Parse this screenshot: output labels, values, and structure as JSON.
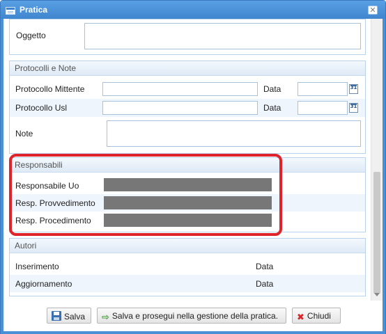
{
  "window": {
    "title": "Pratica",
    "close_glyph": "✕"
  },
  "oggetto": {
    "label": "Oggetto",
    "value": ""
  },
  "protocolli": {
    "header": "Protocolli e Note",
    "mittente_label": "Protocollo Mittente",
    "mittente_value": "",
    "usl_label": "Protocollo Usl",
    "usl_value": "",
    "data_label_1": "Data",
    "data_label_2": "Data",
    "data_value_1": "",
    "data_value_2": "",
    "calendar_text": "31",
    "note_label": "Note",
    "note_value": ""
  },
  "responsabili": {
    "header": "Responsabili",
    "rows": [
      {
        "label": "Responsabile Uo"
      },
      {
        "label": "Resp. Provvedimento"
      },
      {
        "label": "Resp. Procedimento"
      }
    ]
  },
  "autori": {
    "header": "Autori",
    "inserimento_label": "Inserimento",
    "inserimento_data_label": "Data",
    "aggiornamento_label": "Aggiornamento",
    "aggiornamento_data_label": "Data"
  },
  "buttons": {
    "salva": "Salva",
    "salva_prosegui": "Salva e prosegui nella gestione della pratica.",
    "chiudi": "Chiudi"
  },
  "icons": {
    "title": "form-window-icon",
    "close": "close-icon",
    "calendar": "calendar-icon",
    "save": "floppy-disk-icon",
    "proceed": "arrow-right-icon",
    "cancel": "red-x-icon"
  },
  "colors": {
    "title_bar": "#4a90d6",
    "highlight": "#e0222a",
    "redacted": "#777777"
  }
}
